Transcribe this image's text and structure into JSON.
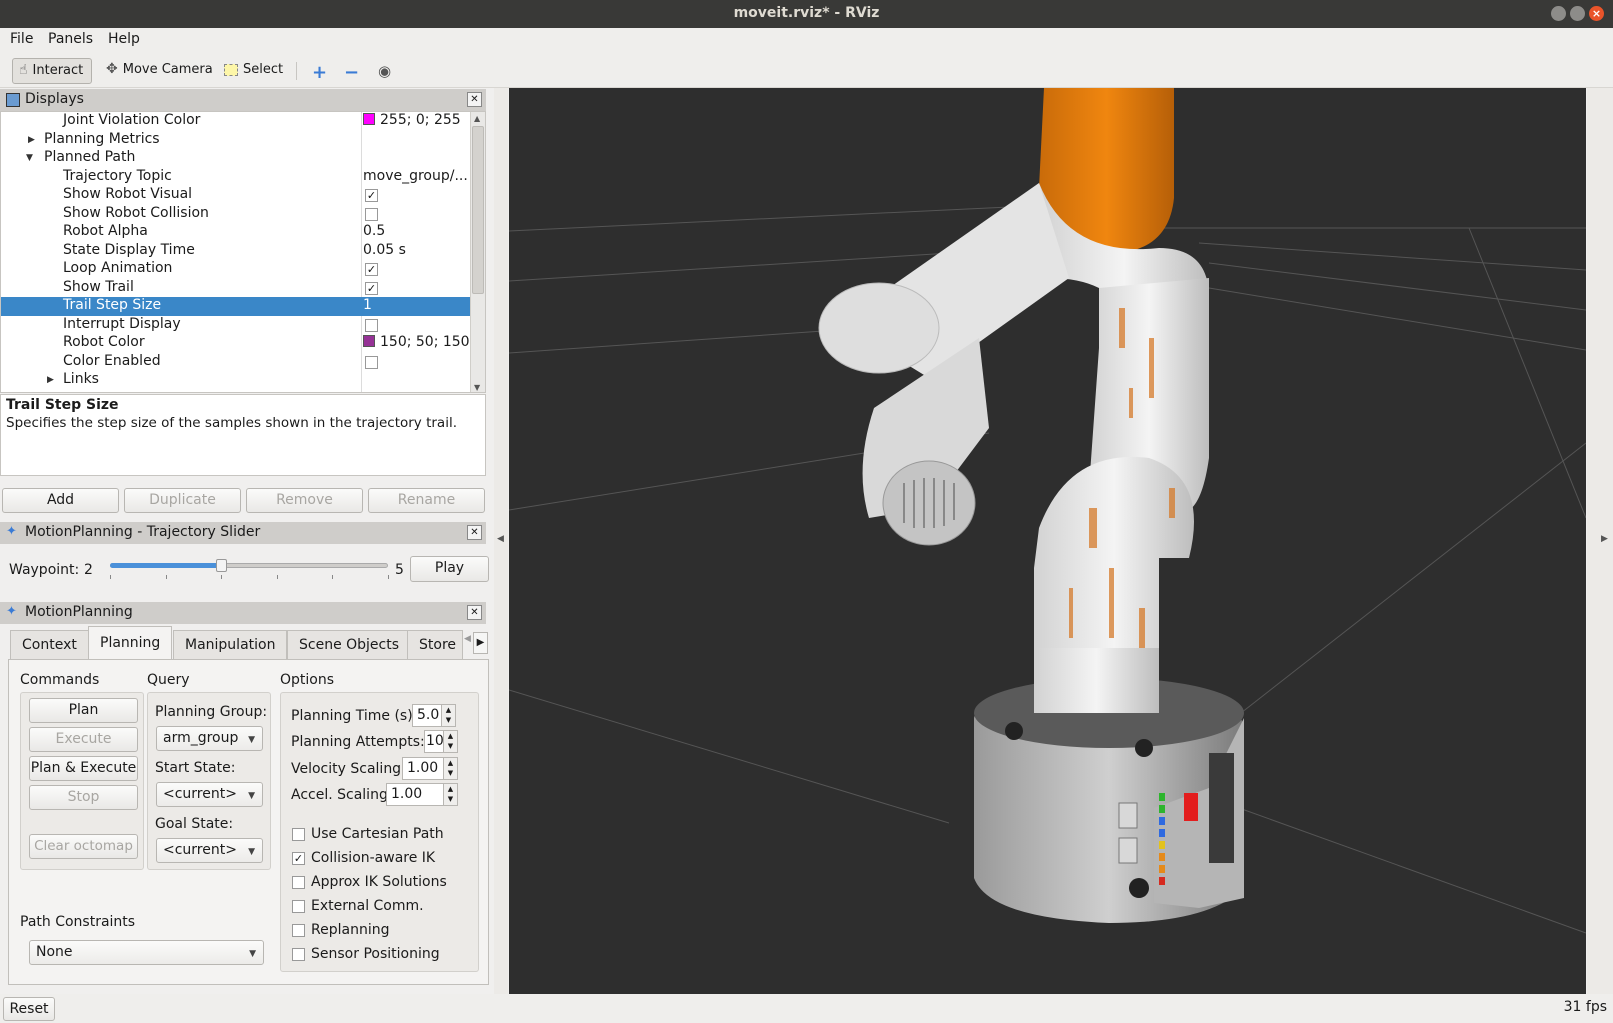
{
  "window": {
    "title": "moveit.rviz* - RViz"
  },
  "menu": {
    "file": "File",
    "panels": "Panels",
    "help": "Help"
  },
  "toolbar": {
    "interact": "Interact",
    "move_camera": "Move Camera",
    "select": "Select",
    "icons": [
      "plus-icon",
      "minus-icon",
      "eye-icon"
    ]
  },
  "displays": {
    "title": "Displays",
    "rows": [
      {
        "label": "Joint Violation Color",
        "value": "255; 0; 255",
        "swatch": "#ff00ff"
      },
      {
        "label": "Planning Metrics"
      },
      {
        "label": "Planned Path"
      },
      {
        "label": "Trajectory Topic",
        "value": "move_group/..."
      },
      {
        "label": "Show Robot Visual",
        "checked": true
      },
      {
        "label": "Show Robot Collision",
        "checked": false
      },
      {
        "label": "Robot Alpha",
        "value": "0.5"
      },
      {
        "label": "State Display Time",
        "value": "0.05 s"
      },
      {
        "label": "Loop Animation",
        "checked": true
      },
      {
        "label": "Show Trail",
        "checked": true
      },
      {
        "label": "Trail Step Size",
        "value": "1"
      },
      {
        "label": "Interrupt Display",
        "checked": false
      },
      {
        "label": "Robot Color",
        "value": "150; 50; 150",
        "swatch": "#963296"
      },
      {
        "label": "Color Enabled",
        "checked": false
      },
      {
        "label": "Links"
      }
    ],
    "description_title": "Trail Step Size",
    "description_text": "Specifies the step size of the samples shown in the trajectory trail.",
    "buttons": {
      "add": "Add",
      "duplicate": "Duplicate",
      "remove": "Remove",
      "rename": "Rename"
    }
  },
  "trajectory_slider": {
    "title": "MotionPlanning - Trajectory Slider",
    "waypoint_label": "Waypoint:",
    "waypoint_value": "2",
    "max_value": "5",
    "play": "Play",
    "position": 0.4
  },
  "motion_planning": {
    "title": "MotionPlanning",
    "tabs": [
      "Context",
      "Planning",
      "Manipulation",
      "Scene Objects",
      "Store"
    ],
    "commands": {
      "heading": "Commands",
      "plan": "Plan",
      "execute": "Execute",
      "plan_execute": "Plan & Execute",
      "stop": "Stop",
      "clear_octomap": "Clear octomap"
    },
    "query": {
      "heading": "Query",
      "planning_group_label": "Planning Group:",
      "planning_group": "arm_group",
      "start_state_label": "Start State:",
      "start_state": "<current>",
      "goal_state_label": "Goal State:",
      "goal_state": "<current>"
    },
    "options": {
      "heading": "Options",
      "planning_time_label": "Planning Time (s):",
      "planning_time": "5.0",
      "planning_attempts_label": "Planning Attempts:",
      "planning_attempts": "10",
      "velocity_scaling_label": "Velocity Scaling:",
      "velocity_scaling": "1.00",
      "accel_scaling_label": "Accel. Scaling:",
      "accel_scaling": "1.00",
      "checks": [
        {
          "label": "Use Cartesian Path",
          "checked": false
        },
        {
          "label": "Collision-aware IK",
          "checked": true
        },
        {
          "label": "Approx IK Solutions",
          "checked": false
        },
        {
          "label": "External Comm.",
          "checked": false
        },
        {
          "label": "Replanning",
          "checked": false
        },
        {
          "label": "Sensor Positioning",
          "checked": false
        }
      ]
    },
    "path_constraints_label": "Path Constraints",
    "path_constraints": "None"
  },
  "status": {
    "reset": "Reset",
    "fps": "31 fps"
  },
  "colors": {
    "selection": "#3a87c8",
    "robot_accent": "#e07a10",
    "viewport_bg": "#2e2e2e"
  }
}
